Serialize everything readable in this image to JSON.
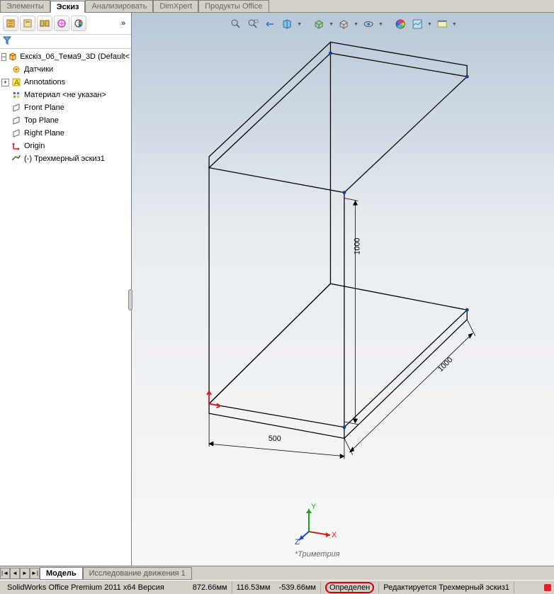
{
  "tabs": {
    "t0": "Элементы",
    "t1": "Эскиз",
    "t2": "Анализировать",
    "t3": "DimXpert",
    "t4": "Продукты Office"
  },
  "tree": {
    "root": "Екскіз_06_Тема9_3D  (Default<",
    "sensors": "Датчики",
    "annotations": "Annotations",
    "material": "Материал <не указан>",
    "front": "Front Plane",
    "top": "Top Plane",
    "right": "Right Plane",
    "origin": "Origin",
    "sketch3d": "(-) Трехмерный эскиз1"
  },
  "dims": {
    "h": "1000",
    "d": "1000",
    "w": "500"
  },
  "triad": {
    "x": "X",
    "y": "Y",
    "z": "Z",
    "view": "*Триметрия"
  },
  "bottom_tabs": {
    "model": "Модель",
    "motion": "Исследование движения 1"
  },
  "status": {
    "app": "SolidWorks Office Premium 2011 x64 Версия",
    "c1": "872.66мм",
    "c2": "116.53мм",
    "c3": "-539.66мм",
    "defined": "Определен",
    "editing": "Редактируется Трехмерный эскиз1"
  }
}
